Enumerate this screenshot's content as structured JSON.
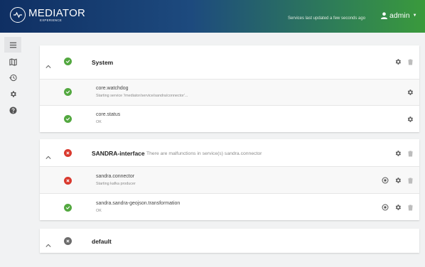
{
  "header": {
    "logo_title": "MEDIATOR",
    "logo_sub": "EXPERIENCE",
    "updated_text": "Services last updated a few seconds ago",
    "user_label": "admin"
  },
  "sidebar": {
    "items": [
      {
        "icon": "menu-icon"
      },
      {
        "icon": "map-icon"
      },
      {
        "icon": "history-icon"
      },
      {
        "icon": "gear-icon"
      },
      {
        "icon": "help-icon"
      }
    ]
  },
  "groups": [
    {
      "name": "System",
      "status": "ok",
      "note": "",
      "services": [
        {
          "name": "core.watchdog",
          "message": "Starting service '/mediator/service/sandra/connector'..."
        },
        {
          "name": "core.status",
          "message": "OK"
        }
      ]
    },
    {
      "name": "SANDRA-interface",
      "status": "error",
      "note": "There are malfunctions in service(s) sandra.connector",
      "services": [
        {
          "name": "sandra.connector",
          "message": "Starting kafka producer"
        },
        {
          "name": "sandra.sandra-geojson.transformation",
          "message": "OK"
        }
      ]
    },
    {
      "name": "default",
      "status": "unknown",
      "note": "",
      "services": []
    }
  ],
  "colors": {
    "ok": "#53a840",
    "error": "#d9392e",
    "unknown": "#6b6b6b",
    "header_start": "#0f2f63",
    "header_end": "#3a9a3c"
  }
}
